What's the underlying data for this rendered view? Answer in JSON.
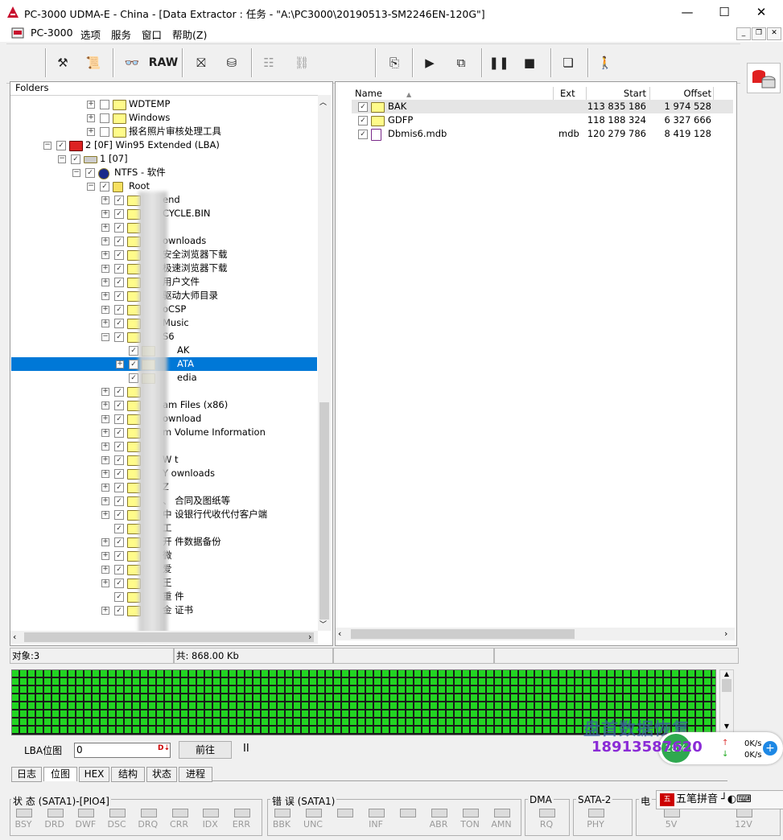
{
  "window": {
    "title": "PC-3000 UDMA-E - China - [Data Extractor : 任务 - \"A:\\PC3000\\20190513-SM2246EN-120G\"]",
    "controls": [
      "—",
      "☐",
      "✕"
    ]
  },
  "menu": {
    "items": [
      "PC-3000",
      "选项",
      "服务",
      "窗口",
      "帮助(Z)"
    ]
  },
  "toolbar": {
    "raw_label": "RAW"
  },
  "folders": {
    "header": "Folders",
    "rows": [
      {
        "label": "WDTEMP"
      },
      {
        "label": "Windows"
      },
      {
        "label": "报名照片审核处理工具"
      },
      {
        "label": "2 [0F] Win95 Extended  (LBA)"
      },
      {
        "label": "1 [07]"
      },
      {
        "label": "NTFS - 软件"
      },
      {
        "label": "Root"
      },
      {
        "label": "end"
      },
      {
        "label": "CYCLE.BIN"
      },
      {
        "label": ""
      },
      {
        "label": "ownloads"
      },
      {
        "label": "安全浏览器下载"
      },
      {
        "label": "极速浏览器下载"
      },
      {
        "label": "用户文件"
      },
      {
        "label": "驱动大师目录"
      },
      {
        "label": "oCSP"
      },
      {
        "label": "Music"
      },
      {
        "label": "S6"
      },
      {
        "label": "AK"
      },
      {
        "label": "ATA"
      },
      {
        "label": "edia"
      },
      {
        "label": ""
      },
      {
        "label": "am Files (x86)"
      },
      {
        "label": "ownload"
      },
      {
        "label": "m Volume Information"
      },
      {
        "label": ""
      },
      {
        "label": "W          t"
      },
      {
        "label": "Y          ownloads"
      },
      {
        "label": "Z"
      },
      {
        "label": "、        合同及图纸等"
      },
      {
        "label": "中        设银行代收代付客户端"
      },
      {
        "label": "工"
      },
      {
        "label": "开        件数据备份"
      },
      {
        "label": "微"
      },
      {
        "label": "爱"
      },
      {
        "label": "王"
      },
      {
        "label": "重          件"
      },
      {
        "label": "金          证书"
      }
    ]
  },
  "files": {
    "columns": [
      "Name",
      "Ext",
      "Start",
      "Offset"
    ],
    "rows": [
      {
        "name": "BAK",
        "ext": "",
        "start": "113 835 186",
        "offset": "1 974 528"
      },
      {
        "name": "GDFP",
        "ext": "",
        "start": "118 188 324",
        "offset": "6 327 666"
      },
      {
        "name": "Dbmis6.mdb",
        "ext": "mdb",
        "start": "120 279 786",
        "offset": "8 419 128"
      }
    ]
  },
  "status": {
    "objects": "对象:3",
    "total": "共: 868.00 Kb"
  },
  "lba": {
    "label": "LBA位图",
    "value": "0",
    "go_label": "前往",
    "pause_label": "II"
  },
  "tabs": [
    "日志",
    "位图",
    "HEX",
    "结构",
    "状态",
    "进程"
  ],
  "indicators": {
    "status_group": "状 态 (SATA1)-[PIO4]",
    "status_leds": [
      "BSY",
      "DRD",
      "DWF",
      "DSC",
      "DRQ",
      "CRR",
      "IDX",
      "ERR"
    ],
    "error_group": "错 误 (SATA1)",
    "error_leds": [
      "BBK",
      "UNC",
      "",
      "INF",
      "",
      "ABR",
      "TON",
      "AMN"
    ],
    "dma_group": "DMA",
    "dma_leds": [
      "RQ"
    ],
    "sata_group": "SATA-2",
    "sata_leds": [
      "PHY"
    ],
    "power_group": "电",
    "power_leds": [
      "5V",
      "12V"
    ]
  },
  "overlays": {
    "watermark_name": "盘首数据恢复",
    "watermark_phone": "18913587620",
    "net_percent": "28%",
    "net_up": "0K/s",
    "net_down": "0K/s",
    "ime_label": "五笔拼音"
  }
}
